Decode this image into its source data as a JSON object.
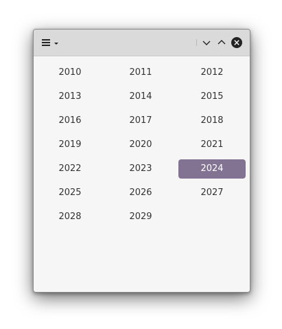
{
  "window": {
    "menu_icon": "hamburger-menu-icon",
    "menu_dropdown_icon": "caret-down-icon",
    "minimize_icon": "chevron-down-icon",
    "maximize_icon": "chevron-up-icon",
    "close_icon": "close-circle-icon"
  },
  "years": [
    "2010",
    "2011",
    "2012",
    "2013",
    "2014",
    "2015",
    "2016",
    "2017",
    "2018",
    "2019",
    "2020",
    "2021",
    "2022",
    "2023",
    "2024",
    "2025",
    "2026",
    "2027",
    "2028",
    "2029"
  ],
  "selected_year": "2024",
  "colors": {
    "selection": "#837393",
    "titlebar": "#dadada",
    "background": "#f6f6f6",
    "text": "#333333"
  }
}
